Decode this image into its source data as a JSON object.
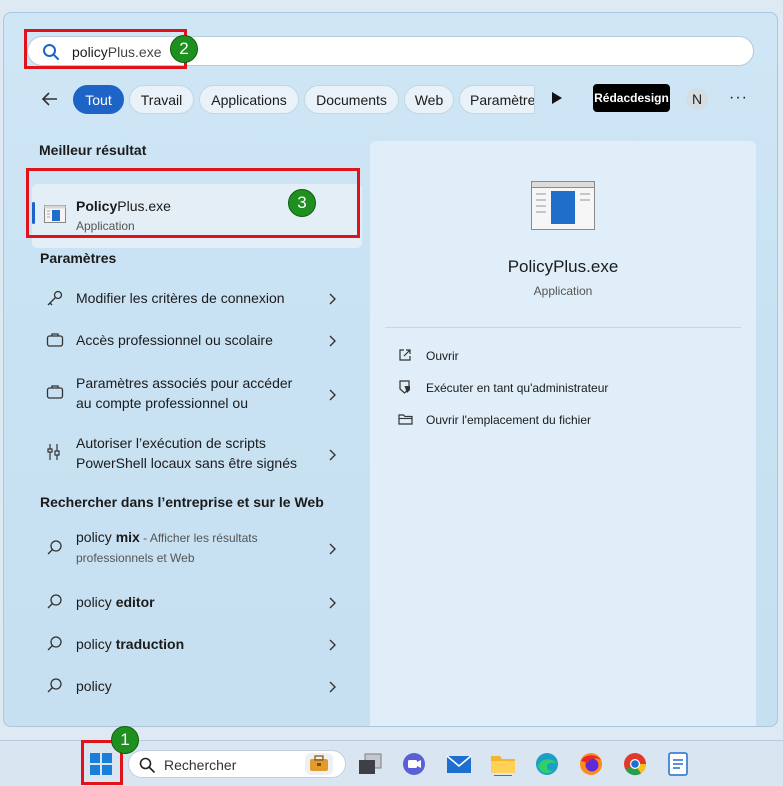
{
  "search": {
    "query_typed": "policy",
    "query_suggested": "Plus.exe"
  },
  "badges": {
    "one": "1",
    "two": "2",
    "three": "3"
  },
  "filters": {
    "tabs": [
      {
        "label": "Tout",
        "active": true
      },
      {
        "label": "Travail"
      },
      {
        "label": "Applications"
      },
      {
        "label": "Documents"
      },
      {
        "label": "Web"
      },
      {
        "label": "Paramètre"
      }
    ],
    "brand": "Rédacdesign",
    "avatar": "N",
    "more": "···"
  },
  "best_match": {
    "title": "Meilleur résultat",
    "name_bold": "Policy",
    "name_rest": "Plus.exe",
    "type": "Application"
  },
  "settings": {
    "title": "Paramètres",
    "items": [
      {
        "line1": "Modifier les critères de connexion",
        "line2": ""
      },
      {
        "line1": "Accès professionnel ou scolaire",
        "line2": ""
      },
      {
        "line1": "Paramètres associés pour accéder",
        "line2": "au compte professionnel ou"
      },
      {
        "line1": "Autoriser l’exécution de scripts",
        "line2": "PowerShell locaux sans être signés"
      }
    ]
  },
  "web": {
    "title": "Rechercher dans l’entreprise et sur le Web",
    "items": [
      {
        "prefix": "policy ",
        "bold": "mix",
        "suffix": " - Afficher les résultats",
        "sub": "professionnels et Web"
      },
      {
        "prefix": "policy ",
        "bold": "editor",
        "suffix": "",
        "sub": ""
      },
      {
        "prefix": "policy ",
        "bold": "traduction",
        "suffix": "",
        "sub": ""
      },
      {
        "prefix": "policy",
        "bold": "",
        "suffix": "",
        "sub": ""
      }
    ]
  },
  "details": {
    "name": "PolicyPlus.exe",
    "type": "Application",
    "actions": [
      {
        "label": "Ouvrir",
        "icon": "open-external-icon"
      },
      {
        "label": "Exécuter en tant qu'administrateur",
        "icon": "shield-icon"
      },
      {
        "label": "Ouvrir l'emplacement du fichier",
        "icon": "folder-icon"
      }
    ]
  },
  "taskbar": {
    "search_placeholder": "Rechercher"
  },
  "colors": {
    "accent": "#1e63c6",
    "highlight_box": "#e0121a",
    "badge": "#1f8f1f"
  }
}
